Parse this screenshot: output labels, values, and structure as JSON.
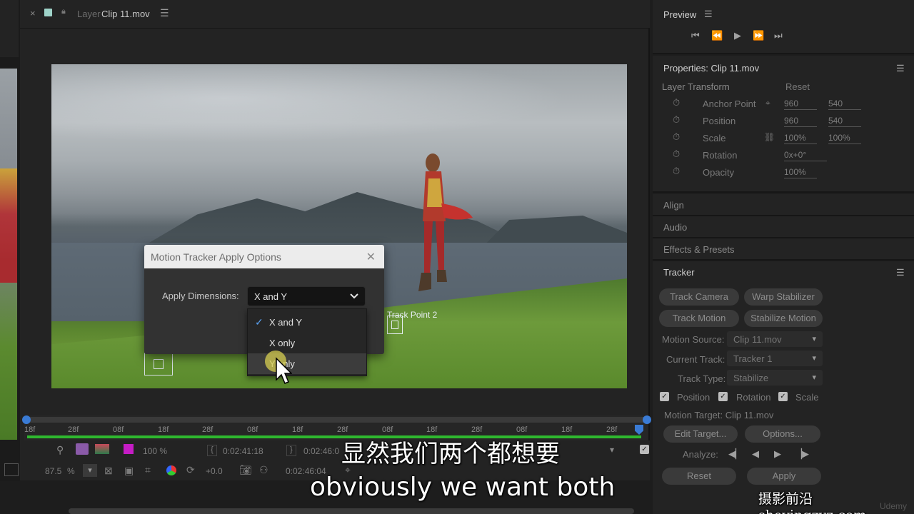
{
  "layer_panel": {
    "tab_prefix": "Layer",
    "tab_title": "Clip 11.mov",
    "menu_icon": "hamburger-icon"
  },
  "dialog": {
    "title": "Motion Tracker Apply Options",
    "apply_dimensions_label": "Apply Dimensions:",
    "selected": "X and Y",
    "options": [
      "X and Y",
      "X only",
      "Y only"
    ],
    "checked_option": "X and Y",
    "hovered_option": "Y only"
  },
  "video": {
    "track_point_label": "Track Point 2"
  },
  "preview": {
    "title": "Preview"
  },
  "properties": {
    "title": "Properties: Clip 11.mov",
    "section": "Layer Transform",
    "reset": "Reset",
    "rows": [
      {
        "label": "Anchor Point",
        "v1": "960",
        "v2": "540"
      },
      {
        "label": "Position",
        "v1": "960",
        "v2": "540"
      },
      {
        "label": "Scale",
        "v1": "100%",
        "v2": "100%"
      },
      {
        "label": "Rotation",
        "v1": "0x+0°",
        "v2": ""
      },
      {
        "label": "Opacity",
        "v1": "100%",
        "v2": ""
      }
    ]
  },
  "collapsed_panels": [
    "Align",
    "Audio",
    "Effects & Presets"
  ],
  "tracker": {
    "title": "Tracker",
    "buttons": [
      "Track Camera",
      "Warp Stabilizer",
      "Track Motion",
      "Stabilize Motion"
    ],
    "motion_source_label": "Motion Source:",
    "motion_source": "Clip 11.mov",
    "current_track_label": "Current Track:",
    "current_track": "Tracker 1",
    "track_type_label": "Track Type:",
    "track_type": "Stabilize",
    "checks": [
      "Position",
      "Rotation",
      "Scale"
    ],
    "motion_target": "Motion Target: Clip 11.mov",
    "edit_target": "Edit Target...",
    "options": "Options...",
    "analyze_label": "Analyze:",
    "reset": "Reset",
    "apply": "Apply"
  },
  "timeline": {
    "ticks": [
      "18f",
      "28f",
      "08f",
      "18f",
      "28f",
      "08f",
      "18f",
      "28f",
      "08f",
      "18f",
      "28f",
      "08f",
      "18f",
      "28f"
    ],
    "zoom_pct": "100 %",
    "time_in": "0:02:41:18",
    "time_out": "0:02:46:0",
    "magnification": "87.5",
    "magnification_unit": "%",
    "exposure": "+0.0",
    "current_time": "0:02:46:04"
  },
  "subtitles": {
    "chinese": "显然我们两个都想要",
    "english": "obviously we want both",
    "watermark": "摄影前沿 sheyingzyz.com",
    "watermark_corner": "Udemy"
  },
  "colors": {
    "accent_blue": "#3a7bd5",
    "timeline_green": "#2fb82f",
    "dialog_check": "#5aa0f0"
  }
}
